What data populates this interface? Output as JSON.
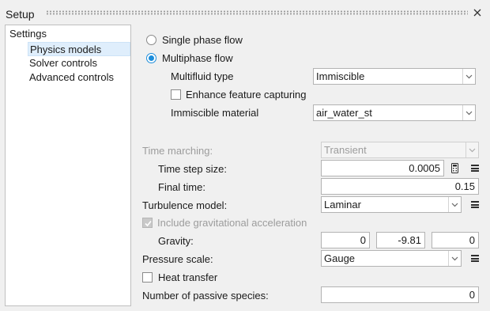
{
  "window": {
    "title": "Setup"
  },
  "tree": {
    "root": "Settings",
    "items": [
      "Physics models",
      "Solver controls",
      "Advanced controls"
    ]
  },
  "flow": {
    "single_phase_label": "Single phase flow",
    "multiphase_label": "Multiphase flow",
    "selected": "Multiphase flow"
  },
  "multifluid": {
    "type_label": "Multifluid type",
    "type_value": "Immiscible",
    "enhance_label": "Enhance feature capturing",
    "enhance_checked": false,
    "material_label": "Immiscible material",
    "material_value": "air_water_st"
  },
  "time": {
    "marching_label": "Time marching:",
    "marching_value": "Transient",
    "step_label": "Time step size:",
    "step_value": "0.0005",
    "final_label": "Final time:",
    "final_value": "0.15"
  },
  "turbulence": {
    "label": "Turbulence model:",
    "value": "Laminar"
  },
  "gravity": {
    "include_label": "Include gravitational acceleration",
    "include_checked": true,
    "label": "Gravity:",
    "x": "0",
    "y": "-9.81",
    "z": "0"
  },
  "pressure": {
    "label": "Pressure scale:",
    "value": "Gauge"
  },
  "heat": {
    "label": "Heat transfer",
    "checked": false
  },
  "species": {
    "label": "Number of passive species:",
    "value": "0"
  },
  "colors": {
    "accent": "#1c8ddb",
    "selection": "#dfeefc",
    "disabled_text": "#9c9c9c"
  },
  "icons": [
    "close-icon",
    "chevron-down-icon",
    "calculator-icon",
    "menu-icon"
  ]
}
